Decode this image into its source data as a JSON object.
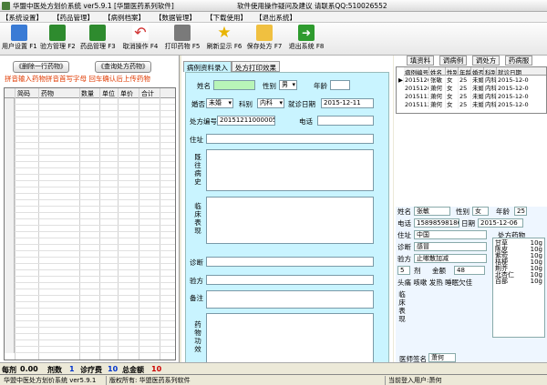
{
  "window": {
    "title": "华盟中医处方划价系统 ver5.9.1 [华盟医药系列软件]",
    "notice": "软件使用操作疑问及建议 请联系QQ:510026552"
  },
  "menu": [
    "【系统设置】",
    "【药品管理】",
    "【病例档案】",
    "【数据管理】",
    "【下载使用】",
    "【退出系统】"
  ],
  "toolbar": [
    {
      "label": "用户设置 F1",
      "icon": "user-settings-icon",
      "color": "#3a7bd5"
    },
    {
      "label": "验方管理 F2",
      "icon": "prescription-book-icon",
      "color": "#2e8b2e"
    },
    {
      "label": "药品管理 F3",
      "icon": "medicine-book-icon",
      "color": "#2e8b2e"
    },
    {
      "label": "取消操作 F4",
      "icon": "undo-icon",
      "color": "#d03030"
    },
    {
      "label": "打印药物 F5",
      "icon": "printer-icon",
      "color": "#5a5a5a"
    },
    {
      "label": "刷新显示 F6",
      "icon": "star-refresh-icon",
      "color": "#e8b400"
    },
    {
      "label": "保存处方 F7",
      "icon": "folder-save-icon",
      "color": "#e8b400"
    },
    {
      "label": "退出系统 F8",
      "icon": "exit-icon",
      "color": "#2e9b2e"
    }
  ],
  "left": {
    "delete_button": "《删除一行药物》",
    "recipe_button": "《查询处方药物》",
    "hint": "拼音输入药物拼音首写字母  回车确认后上传药物",
    "grid_headers": [
      "简码",
      "药物",
      "数量",
      "单位",
      "单价",
      "合计"
    ]
  },
  "tabs": [
    "病例资料录入",
    "处方打印效果"
  ],
  "form": {
    "name_label": "姓名",
    "sex_label": "性别",
    "sex_value": "男",
    "age_label": "年龄",
    "marital_label": "婚否",
    "marital_value": "未婚",
    "dept_label": "科别",
    "dept_value": "内科",
    "date_label": "就诊日期",
    "date_value": "2015-12-11",
    "rx_label": "处方编号",
    "rx_value": "20151211000005",
    "phone_label": "电话",
    "address_label": "住址",
    "history_label": "既往病史",
    "clinical_label": "临床表现",
    "diagnosis_label": "诊断",
    "formula_label": "验方",
    "remark_label": "备注",
    "efficacy_label": "药物功效"
  },
  "right": {
    "tabs": [
      "填资料",
      "调病例",
      "调处方",
      "药病服"
    ],
    "table_headers": [
      "病例编号",
      "姓名",
      "性别",
      "年龄",
      "婚否",
      "科别",
      "就诊日期"
    ],
    "rows": [
      [
        "2015120",
        "张敏",
        "女",
        "25",
        "未婚",
        "内科",
        "2015-12-0"
      ],
      [
        "2015120",
        "萧何",
        "女",
        "25",
        "未婚",
        "内科",
        "2015-12-0"
      ],
      [
        "2015113",
        "萧何",
        "女",
        "25",
        "未婚",
        "内科",
        "2015-12-0"
      ],
      [
        "2015112",
        "萧何",
        "女",
        "25",
        "未婚",
        "内科",
        "2015-12-0"
      ]
    ],
    "detail": {
      "name_label": "姓名",
      "name_value": "张敏",
      "sex_label": "性别",
      "sex_value": "女",
      "age_label": "年龄",
      "age_value": "25",
      "phone_label": "电话",
      "phone_value": "15898598186",
      "date_label": "日期",
      "date_value": "2015-12-06",
      "address_label": "住址",
      "address_value": "中国",
      "herb_title": "处方药物",
      "diagnosis_label": "诊断",
      "diagnosis_value": "感冒",
      "formula_label": "验方",
      "formula_value": "止嗽散加减",
      "doses_value": "5",
      "doses_label": "剂",
      "amount_label": "金额",
      "amount_value": "48",
      "clinical_value": "头痛 咳嗽 发热 睡眠欠佳",
      "clinical_label": "临床表现",
      "doctor_label": "医师签名",
      "doctor_value": "萧何"
    },
    "herbs": [
      {
        "name": "甘草",
        "dose": "10g"
      },
      {
        "name": "陈皮",
        "dose": "10g"
      },
      {
        "name": "紫菀",
        "dose": "10g"
      },
      {
        "name": "桔梗",
        "dose": "10g"
      },
      {
        "name": "荆芥",
        "dose": "10g"
      },
      {
        "name": "北杏仁",
        "dose": "10g"
      },
      {
        "name": "百部",
        "dose": "10g"
      }
    ]
  },
  "footer": {
    "doses_label": "每剂",
    "doses_value": "0.00",
    "count_label": "剂数",
    "count_value": "1",
    "fee_label": "诊疗费",
    "fee_value": "10",
    "total_label": "总金额",
    "total_value": "10"
  },
  "status": {
    "app": "华盟中医处方划价系统 ver5.9.1",
    "copyright": "版权所有: 华盟医药系列软件",
    "user": "当前登入用户:萧何"
  }
}
